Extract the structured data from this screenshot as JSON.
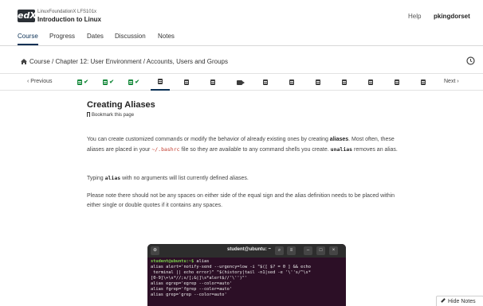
{
  "header": {
    "logo": "edX",
    "course_org": "LinuxFoundationX LFS101x",
    "course_title": "Introduction to Linux",
    "help": "Help",
    "username": "pkingdorset"
  },
  "tabs": [
    "Course",
    "Progress",
    "Dates",
    "Discussion",
    "Notes"
  ],
  "breadcrumb": "Course / Chapter 12: User Environment / Accounts, Users and Groups",
  "sequence": {
    "prev_label": "‹  Previous",
    "next_label": "Next  ›",
    "check_mark": "✔"
  },
  "content": {
    "title": "Creating Aliases",
    "bookmark": "Bookmark this page",
    "p1_a": "You can create customized commands or modify the behavior of already existing ones by creating ",
    "p1_b": "aliases",
    "p1_c": ". Most often, these aliases are placed in your ",
    "p1_code": "~/.bashrc",
    "p1_d": " file so they are available to any command shells you create. ",
    "p1_code2": "unalias",
    "p1_e": " removes an alias.",
    "p2_a": "Typing ",
    "p2_code": "alias",
    "p2_b": " with no arguments will list currently defined aliases.",
    "p3": "Please note there should not be any spaces on either side of the equal sign and the alias definition needs to be placed within either single or double quotes if it contains any spaces."
  },
  "terminal": {
    "title": "student@ubuntu: ~",
    "prompt": "student@ubuntu:~$",
    "command": " alias",
    "lines": [
      "alias alert='notify-send --urgency=low -i \"$([ $? = 0 ] && echo",
      " terminal || echo error)\" \"$(history|tail -n1|sed -e '\\''s/^\\s*",
      "[0-9]\\+\\s*//;s/[;&|]\\s*alert$//'\\'')\"'",
      "alias egrep='egrep --color=auto'",
      "alias fgrep='fgrep --color=auto'",
      "alias grep='grep --color=auto'"
    ]
  },
  "hide_notes": "Hide Notes"
}
